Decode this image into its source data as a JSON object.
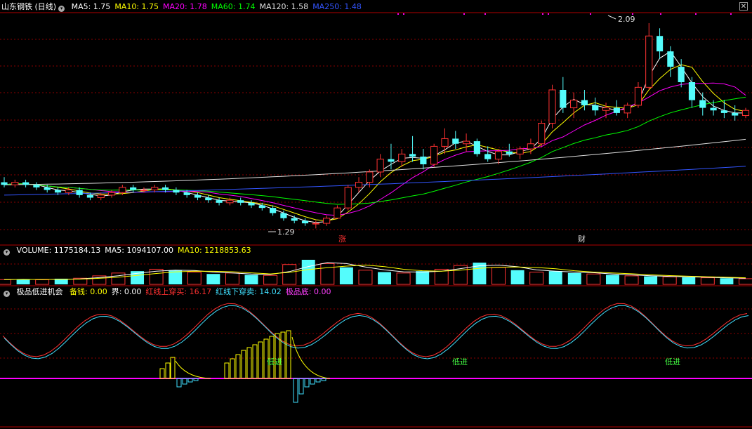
{
  "header": {
    "stock": "山东钢铁 (日线)",
    "ma": [
      {
        "label": "MA5: 1.75",
        "color": "#ffffff"
      },
      {
        "label": "MA10: 1.75",
        "color": "#ffff00"
      },
      {
        "label": "MA20: 1.78",
        "color": "#ff00ff"
      },
      {
        "label": "MA60: 1.74",
        "color": "#00ff00"
      },
      {
        "label": "MA120: 1.58",
        "color": "#e0e0e0"
      },
      {
        "label": "MA250: 1.48",
        "color": "#3355ff"
      }
    ]
  },
  "volume_header": {
    "items": [
      {
        "label": "VOLUME: 1175184.13",
        "color": "#ffffff"
      },
      {
        "label": "MA5: 1094107.00",
        "color": "#ffffff"
      },
      {
        "label": "MA10: 1218853.63",
        "color": "#ffff00"
      }
    ]
  },
  "indicator_header": {
    "name": "极品低进机会",
    "items": [
      {
        "label": "备钱: 0.00",
        "color": "#ffff00"
      },
      {
        "label": "界: 0.00",
        "color": "#ffffff"
      },
      {
        "label": "红线上穿买: 16.17",
        "color": "#ff3030"
      },
      {
        "label": "红线下穿卖: 14.02",
        "color": "#40e0ff"
      },
      {
        "label": "极品底: 0.00",
        "color": "#ff40ff"
      }
    ]
  },
  "annotations": {
    "high": "2.09",
    "low": "1.29",
    "mark1": "涨",
    "mark2": "财",
    "signal": "低进"
  },
  "colors": {
    "up": "#ff3232",
    "down": "#54fcfc",
    "grid": "#8b0000",
    "magenta": "#ff00ff"
  },
  "chart_data": {
    "type": "candlestick",
    "price_range_approx": [
      1.25,
      2.12
    ],
    "high": 2.09,
    "low": 1.29,
    "ohlc_approx": [
      [
        1.47,
        1.49,
        1.45,
        1.46
      ],
      [
        1.46,
        1.48,
        1.45,
        1.47
      ],
      [
        1.47,
        1.48,
        1.45,
        1.46
      ],
      [
        1.46,
        1.47,
        1.44,
        1.45
      ],
      [
        1.45,
        1.46,
        1.43,
        1.44
      ],
      [
        1.44,
        1.45,
        1.42,
        1.43
      ],
      [
        1.43,
        1.45,
        1.42,
        1.44
      ],
      [
        1.44,
        1.45,
        1.41,
        1.42
      ],
      [
        1.42,
        1.43,
        1.4,
        1.41
      ],
      [
        1.41,
        1.43,
        1.4,
        1.42
      ],
      [
        1.42,
        1.44,
        1.41,
        1.43
      ],
      [
        1.43,
        1.46,
        1.42,
        1.45
      ],
      [
        1.45,
        1.46,
        1.43,
        1.44
      ],
      [
        1.44,
        1.45,
        1.43,
        1.44
      ],
      [
        1.44,
        1.46,
        1.43,
        1.45
      ],
      [
        1.45,
        1.46,
        1.43,
        1.44
      ],
      [
        1.44,
        1.45,
        1.42,
        1.43
      ],
      [
        1.43,
        1.44,
        1.41,
        1.42
      ],
      [
        1.42,
        1.43,
        1.4,
        1.41
      ],
      [
        1.41,
        1.42,
        1.39,
        1.4
      ],
      [
        1.4,
        1.41,
        1.38,
        1.39
      ],
      [
        1.39,
        1.41,
        1.38,
        1.4
      ],
      [
        1.4,
        1.41,
        1.38,
        1.39
      ],
      [
        1.39,
        1.4,
        1.37,
        1.38
      ],
      [
        1.38,
        1.39,
        1.36,
        1.37
      ],
      [
        1.37,
        1.38,
        1.34,
        1.35
      ],
      [
        1.35,
        1.36,
        1.32,
        1.33
      ],
      [
        1.33,
        1.34,
        1.31,
        1.32
      ],
      [
        1.32,
        1.33,
        1.3,
        1.31
      ],
      [
        1.31,
        1.32,
        1.29,
        1.31
      ],
      [
        1.31,
        1.34,
        1.3,
        1.33
      ],
      [
        1.33,
        1.38,
        1.33,
        1.37
      ],
      [
        1.37,
        1.46,
        1.36,
        1.45
      ],
      [
        1.45,
        1.49,
        1.43,
        1.47
      ],
      [
        1.47,
        1.52,
        1.45,
        1.51
      ],
      [
        1.51,
        1.58,
        1.49,
        1.56
      ],
      [
        1.56,
        1.62,
        1.52,
        1.55
      ],
      [
        1.55,
        1.6,
        1.53,
        1.58
      ],
      [
        1.58,
        1.65,
        1.55,
        1.57
      ],
      [
        1.57,
        1.6,
        1.52,
        1.54
      ],
      [
        1.54,
        1.62,
        1.53,
        1.61
      ],
      [
        1.61,
        1.68,
        1.58,
        1.64
      ],
      [
        1.64,
        1.67,
        1.6,
        1.62
      ],
      [
        1.62,
        1.66,
        1.59,
        1.63
      ],
      [
        1.63,
        1.64,
        1.57,
        1.58
      ],
      [
        1.58,
        1.61,
        1.55,
        1.56
      ],
      [
        1.56,
        1.6,
        1.54,
        1.59
      ],
      [
        1.59,
        1.62,
        1.57,
        1.58
      ],
      [
        1.58,
        1.61,
        1.56,
        1.6
      ],
      [
        1.6,
        1.64,
        1.58,
        1.62
      ],
      [
        1.62,
        1.71,
        1.61,
        1.7
      ],
      [
        1.7,
        1.85,
        1.68,
        1.83
      ],
      [
        1.83,
        1.88,
        1.74,
        1.76
      ],
      [
        1.76,
        1.82,
        1.72,
        1.79
      ],
      [
        1.79,
        1.83,
        1.75,
        1.77
      ],
      [
        1.77,
        1.8,
        1.73,
        1.75
      ],
      [
        1.75,
        1.78,
        1.72,
        1.76
      ],
      [
        1.76,
        1.79,
        1.73,
        1.74
      ],
      [
        1.74,
        1.78,
        1.72,
        1.77
      ],
      [
        1.77,
        1.86,
        1.76,
        1.84
      ],
      [
        1.84,
        2.09,
        1.83,
        2.04
      ],
      [
        2.04,
        2.07,
        1.95,
        1.98
      ],
      [
        1.98,
        2.0,
        1.88,
        1.92
      ],
      [
        1.92,
        1.95,
        1.84,
        1.86
      ],
      [
        1.86,
        1.88,
        1.76,
        1.79
      ],
      [
        1.79,
        1.82,
        1.73,
        1.76
      ],
      [
        1.76,
        1.79,
        1.73,
        1.75
      ],
      [
        1.75,
        1.79,
        1.72,
        1.74
      ],
      [
        1.74,
        1.77,
        1.71,
        1.73
      ],
      [
        1.73,
        1.76,
        1.72,
        1.75
      ]
    ],
    "volume_approx": [
      {
        "v": 50,
        "up": true
      },
      {
        "v": 55,
        "up": false
      },
      {
        "v": 48,
        "up": true
      },
      {
        "v": 60,
        "up": false
      },
      {
        "v": 65,
        "up": true
      },
      {
        "v": 90,
        "up": true
      },
      {
        "v": 120,
        "up": true
      },
      {
        "v": 140,
        "up": false
      },
      {
        "v": 160,
        "up": true
      },
      {
        "v": 150,
        "up": false
      },
      {
        "v": 130,
        "up": true
      },
      {
        "v": 110,
        "up": false
      },
      {
        "v": 120,
        "up": true
      },
      {
        "v": 100,
        "up": false
      },
      {
        "v": 95,
        "up": true
      },
      {
        "v": 210,
        "up": true
      },
      {
        "v": 260,
        "up": false
      },
      {
        "v": 220,
        "up": true
      },
      {
        "v": 180,
        "up": false
      },
      {
        "v": 150,
        "up": true
      },
      {
        "v": 130,
        "up": false
      },
      {
        "v": 120,
        "up": true
      },
      {
        "v": 140,
        "up": false
      },
      {
        "v": 160,
        "up": true
      },
      {
        "v": 200,
        "up": true
      },
      {
        "v": 230,
        "up": false
      },
      {
        "v": 180,
        "up": true
      },
      {
        "v": 150,
        "up": false
      },
      {
        "v": 130,
        "up": true
      },
      {
        "v": 140,
        "up": false
      },
      {
        "v": 120,
        "up": false
      },
      {
        "v": 110,
        "up": true
      },
      {
        "v": 100,
        "up": false
      },
      {
        "v": 90,
        "up": true
      },
      {
        "v": 85,
        "up": false
      },
      {
        "v": 80,
        "up": true
      },
      {
        "v": 75,
        "up": false
      },
      {
        "v": 70,
        "up": true
      },
      {
        "v": 65,
        "up": false
      },
      {
        "v": 60,
        "up": true
      }
    ]
  }
}
